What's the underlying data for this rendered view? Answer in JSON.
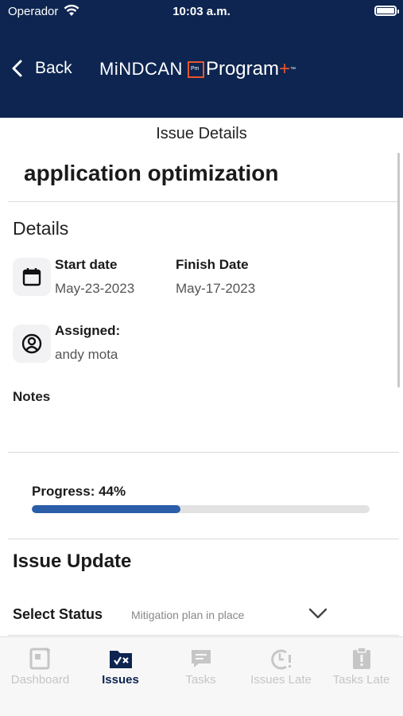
{
  "status_bar": {
    "carrier": "Operador",
    "time": "10:03 a.m."
  },
  "header": {
    "back_label": "Back",
    "logo": {
      "brand": "MiNDCAN",
      "box_text": "Pm",
      "product": "Program",
      "plus": "+",
      "tm": "™"
    }
  },
  "nav_title": "Issue Details",
  "issue": {
    "title": "application optimization"
  },
  "details": {
    "heading": "Details",
    "start_date": {
      "label": "Start date",
      "value": "May-23-2023"
    },
    "finish_date": {
      "label": "Finish Date",
      "value": "May-17-2023"
    },
    "assigned": {
      "label": "Assigned:",
      "value": "andy mota"
    },
    "notes_label": "Notes"
  },
  "progress": {
    "label": "Progress: 44%",
    "percent": 44
  },
  "issue_update": {
    "heading": "Issue Update",
    "status_label": "Select Status",
    "status_value": "Mitigation plan in place"
  },
  "tabs": [
    {
      "label": "Dashboard",
      "icon": "dashboard-icon",
      "active": false
    },
    {
      "label": "Issues",
      "icon": "issues-folder-icon",
      "active": true
    },
    {
      "label": "Tasks",
      "icon": "tasks-chat-icon",
      "active": false
    },
    {
      "label": "Issues Late",
      "icon": "issues-late-icon",
      "active": false
    },
    {
      "label": "Tasks Late",
      "icon": "tasks-late-icon",
      "active": false
    }
  ],
  "colors": {
    "header_bg": "#0d2550",
    "accent_orange": "#e8552d",
    "progress_fill": "#2a5ea8",
    "tab_active": "#0d2550",
    "tab_inactive": "#c6c6c6"
  }
}
